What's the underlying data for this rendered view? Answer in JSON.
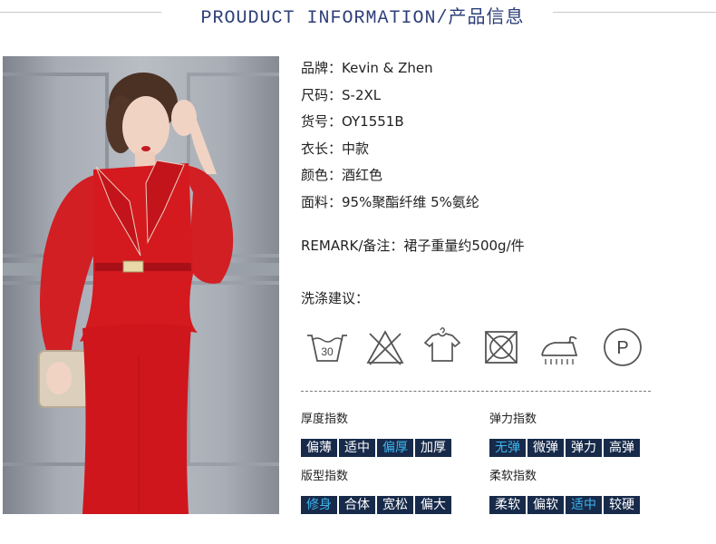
{
  "header": {
    "title": "PROUDUCT INFORMATION/产品信息"
  },
  "details": [
    {
      "key": "品牌：",
      "value": "Kevin & Zhen"
    },
    {
      "key": "尺码：",
      "value": "S-2XL"
    },
    {
      "key": "货号：",
      "value": "OY1551B"
    },
    {
      "key": "衣长：",
      "value": "中款"
    },
    {
      "key": "颜色：",
      "value": "酒红色"
    },
    {
      "key": "面料：",
      "value": "95%聚酯纤维 5%氨纶"
    }
  ],
  "remark": {
    "key": "REMARK/备注：",
    "value": "裙子重量约500g/件"
  },
  "wash": {
    "title": "洗涤建议：",
    "icons": [
      "wash-30-icon",
      "no-bleach-icon",
      "hang-dry-icon",
      "no-tumble-dry-icon",
      "iron-icon",
      "dry-clean-p-icon"
    ],
    "temp": "30",
    "dryclean_letter": "P"
  },
  "indices": {
    "thickness": {
      "title": "厚度指数",
      "options": [
        "偏薄",
        "适中",
        "偏厚",
        "加厚"
      ],
      "selected": 2
    },
    "elasticity": {
      "title": "弹力指数",
      "options": [
        "无弹",
        "微弹",
        "弹力",
        "高弹"
      ],
      "selected": 0
    },
    "fit": {
      "title": "版型指数",
      "options": [
        "修身",
        "合体",
        "宽松",
        "偏大"
      ],
      "selected": 0
    },
    "softness": {
      "title": "柔软指数",
      "options": [
        "柔软",
        "偏软",
        "适中",
        "较硬"
      ],
      "selected": 2
    }
  },
  "colors": {
    "accent_navy": "#172a4a",
    "selected_text": "#3fb5ee",
    "header_text": "#2d3e78",
    "dress_red": "#c8171e"
  }
}
